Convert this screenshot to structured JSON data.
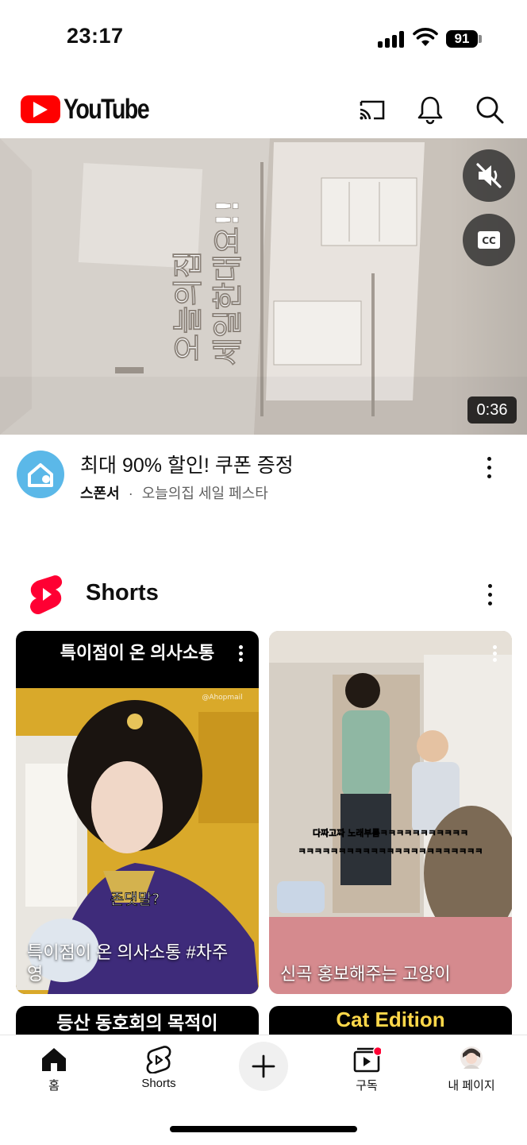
{
  "status_bar": {
    "time": "23:17",
    "battery": "91"
  },
  "header": {
    "logo_text": "YouTube",
    "icons": [
      "cast-icon",
      "bell-icon",
      "search-icon"
    ]
  },
  "ad": {
    "video_caption_line1": "오늘의집",
    "video_caption_line2": "세일한대요!!",
    "duration": "0:36",
    "title": "최대 90% 할인! 쿠폰 증정",
    "sponsor_label": "스폰서",
    "separator": "·",
    "advertiser": "오늘의집 세일 페스타"
  },
  "shorts": {
    "section_title": "Shorts",
    "cards": [
      {
        "top_text": "특이점이 온 의사소통",
        "title": "특이점이 온 의사소통 #차주영",
        "subtitle": "존댓말?",
        "watermark": "@Ahopmail"
      },
      {
        "title": "신곡 홍보해주는 고양이",
        "subtitle_line1": "다짜고짜 노래부름ㅋㅋㅋㅋㅋㅋㅋㅋㅋㅋㅋ",
        "subtitle_line2": "ㅋㅋㅋㅋㅋㅋㅋㅋㅋㅋㅋㅋㅋㅋㅋㅋㅋㅋㅋㅋㅋㅋㅋ"
      },
      {
        "title": "등산 동호회의 목적이"
      },
      {
        "title": "Cat Edition"
      }
    ]
  },
  "bottom_nav": {
    "items": [
      {
        "label": "홈"
      },
      {
        "label": "Shorts"
      },
      {
        "label": "구독"
      },
      {
        "label": "내 페이지"
      }
    ]
  },
  "colors": {
    "brand_red": "#ff0000",
    "ad_avatar": "#5bb8e8",
    "notification_dot": "#ff0033"
  }
}
